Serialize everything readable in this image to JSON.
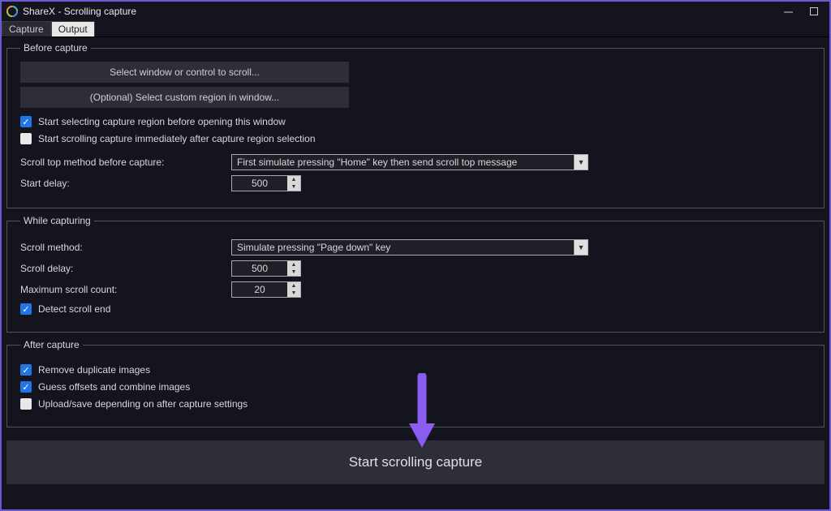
{
  "window": {
    "title": "ShareX - Scrolling capture"
  },
  "tabs": {
    "capture": "Capture",
    "output": "Output"
  },
  "before": {
    "legend": "Before capture",
    "select_window": "Select window or control to scroll...",
    "custom_region": "(Optional) Select custom region in window...",
    "start_selecting": "Start selecting capture region before opening this window",
    "start_scrolling_immediately": "Start scrolling capture immediately after capture region selection",
    "scroll_top_method_label": "Scroll top method before capture:",
    "scroll_top_method_value": "First simulate pressing \"Home\" key then send scroll top message",
    "start_delay_label": "Start delay:",
    "start_delay_value": "500"
  },
  "while": {
    "legend": "While capturing",
    "scroll_method_label": "Scroll method:",
    "scroll_method_value": "Simulate pressing \"Page down\" key",
    "scroll_delay_label": "Scroll delay:",
    "scroll_delay_value": "500",
    "max_scroll_label": "Maximum scroll count:",
    "max_scroll_value": "20",
    "detect_scroll_end": "Detect scroll end"
  },
  "after": {
    "legend": "After capture",
    "remove_dup": "Remove duplicate images",
    "guess_offsets": "Guess offsets and combine images",
    "upload_save": "Upload/save depending on after capture settings"
  },
  "start_button": "Start scrolling capture"
}
